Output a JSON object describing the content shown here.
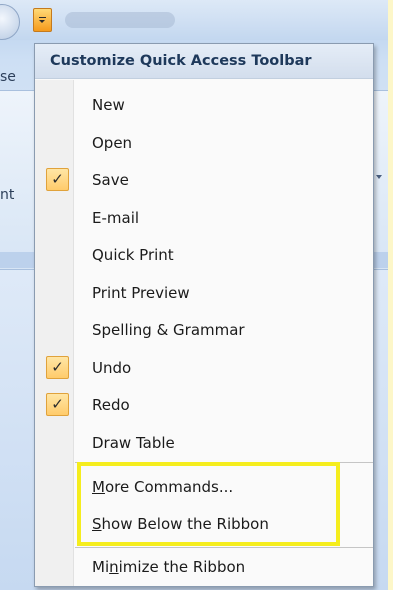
{
  "menu": {
    "title": "Customize Quick Access Toolbar",
    "items": [
      {
        "label": "New",
        "checked": false
      },
      {
        "label": "Open",
        "checked": false
      },
      {
        "label": "Save",
        "checked": true
      },
      {
        "label": "E-mail",
        "checked": false
      },
      {
        "label": "Quick Print",
        "checked": false
      },
      {
        "label": "Print Preview",
        "checked": false
      },
      {
        "label": "Spelling & Grammar",
        "checked": false
      },
      {
        "label": "Undo",
        "checked": true
      },
      {
        "label": "Redo",
        "checked": true
      },
      {
        "label": "Draw Table",
        "checked": false
      }
    ],
    "more_commands": {
      "label": "More Commands...",
      "accel": "M",
      "rest": "ore Commands..."
    },
    "show_below": {
      "label": "Show Below the Ribbon",
      "accel": "S",
      "rest": "how Below the Ribbon"
    },
    "minimize": {
      "label": "Minimize the Ribbon",
      "pre": "Mi",
      "accel": "n",
      "rest": "imize the Ribbon"
    },
    "check_glyph": "✓"
  },
  "background": {
    "tab_fragment_top": "se",
    "tab_fragment_mid": "nt"
  },
  "colors": {
    "highlight": "#f5ed1d",
    "check_fill": "#ffcb6b",
    "page": "#fdf7c9"
  }
}
